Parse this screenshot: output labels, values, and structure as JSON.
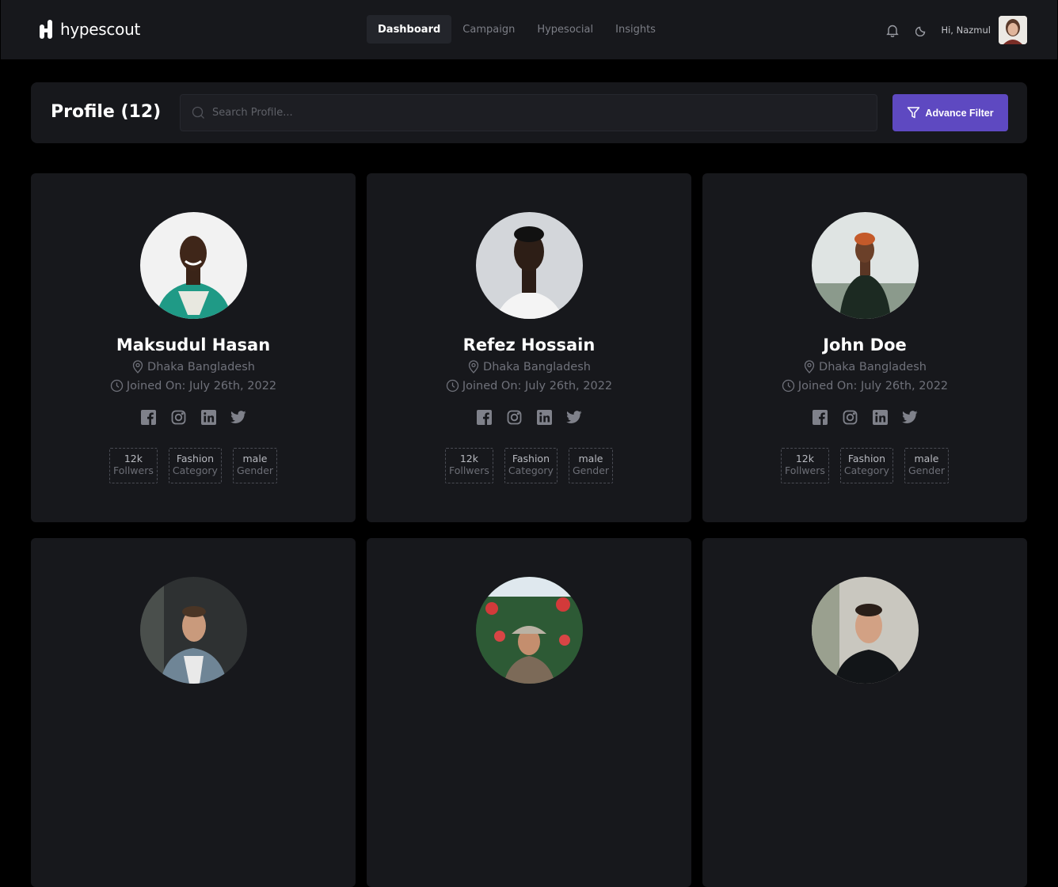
{
  "app": {
    "brand": "hypescout",
    "nav": [
      "Dashboard",
      "Campaign",
      "Hypesocial",
      "Insights"
    ],
    "active_nav": "Dashboard",
    "greeting": "Hi, Nazmul"
  },
  "header": {
    "title": "Profile (12)",
    "search_placeholder": "Search Profile...",
    "filter_label": "Advance Filter"
  },
  "profiles": [
    {
      "name": "Maksudul Hasan",
      "location": "Dhaka Bangladesh",
      "joined": "Joined On: July 26th, 2022",
      "stats": [
        {
          "value": "12k",
          "label": "Follwers"
        },
        {
          "value": "Fashion",
          "label": "Category"
        },
        {
          "value": "male",
          "label": "Gender"
        }
      ]
    },
    {
      "name": "Refez Hossain",
      "location": "Dhaka Bangladesh",
      "joined": "Joined On: July 26th, 2022",
      "stats": [
        {
          "value": "12k",
          "label": "Follwers"
        },
        {
          "value": "Fashion",
          "label": "Category"
        },
        {
          "value": "male",
          "label": "Gender"
        }
      ]
    },
    {
      "name": "John Doe",
      "location": "Dhaka Bangladesh",
      "joined": "Joined On: July 26th, 2022",
      "stats": [
        {
          "value": "12k",
          "label": "Follwers"
        },
        {
          "value": "Fashion",
          "label": "Category"
        },
        {
          "value": "male",
          "label": "Gender"
        }
      ]
    }
  ],
  "colors": {
    "accent": "#5e49c1",
    "card": "#17181c",
    "background": "#000000"
  }
}
